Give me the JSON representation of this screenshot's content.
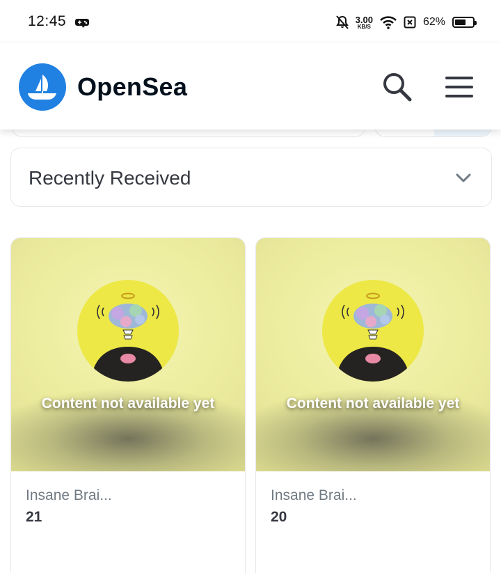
{
  "status_bar": {
    "time": "12:45",
    "net_speed_value": "3.00",
    "net_speed_unit": "KB/S",
    "battery_percent": "62%",
    "battery_level": 0.62
  },
  "header": {
    "brand": "OpenSea",
    "brand_color": "#2081e2"
  },
  "sort": {
    "selected": "Recently Received"
  },
  "items": [
    {
      "name": "Insane Brai...",
      "number": "21",
      "status": "Content not available yet"
    },
    {
      "name": "Insane Brai...",
      "number": "20",
      "status": "Content not available yet"
    }
  ]
}
